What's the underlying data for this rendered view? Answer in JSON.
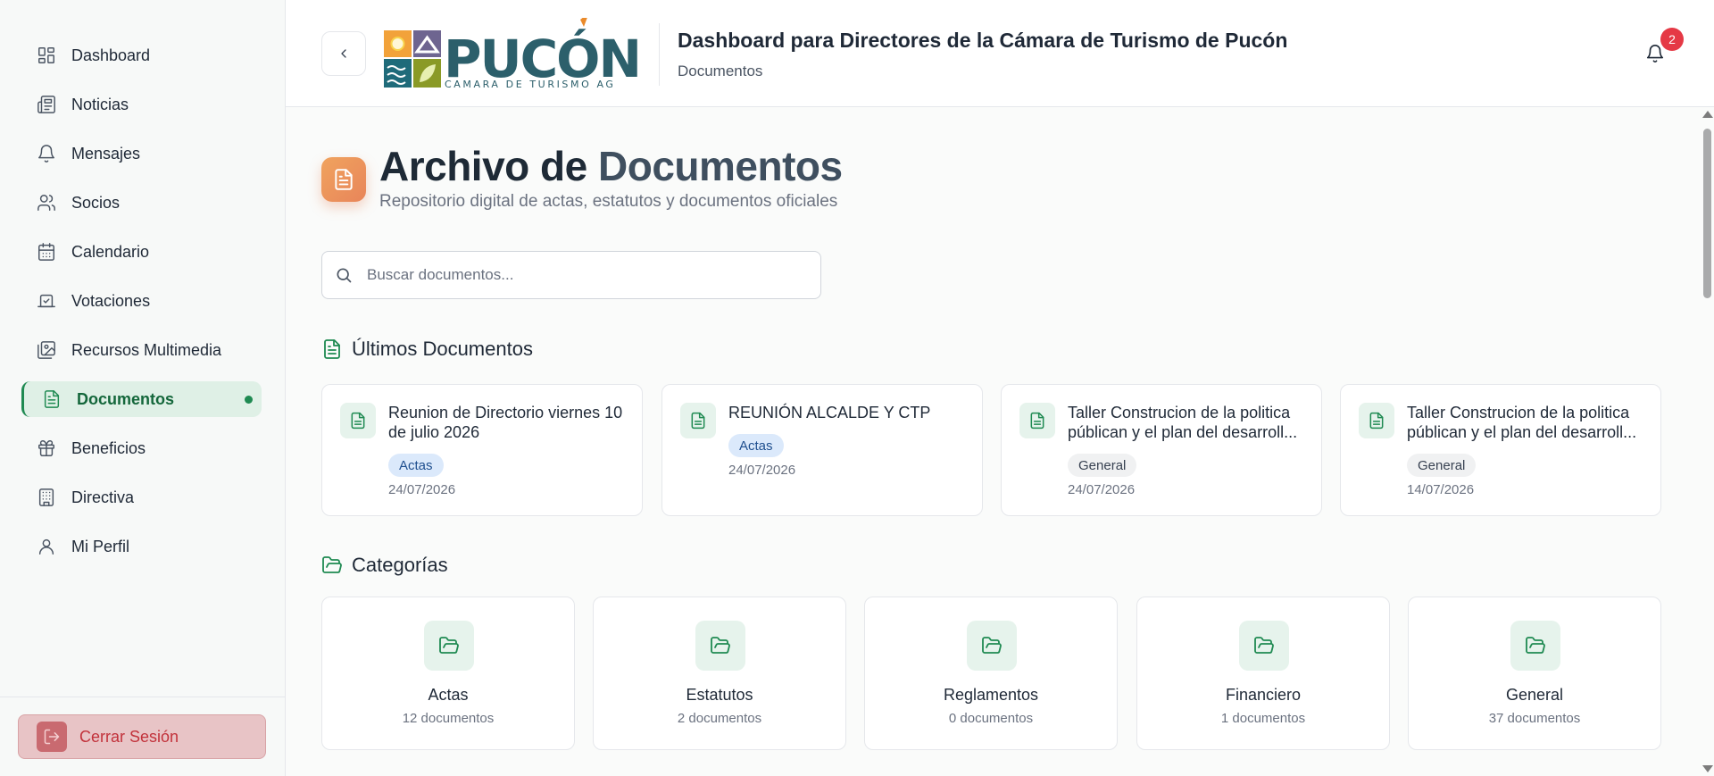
{
  "sidebar": {
    "items": [
      {
        "label": "Dashboard",
        "icon": "dashboard-icon"
      },
      {
        "label": "Noticias",
        "icon": "newspaper-icon"
      },
      {
        "label": "Mensajes",
        "icon": "bell-icon"
      },
      {
        "label": "Socios",
        "icon": "users-icon"
      },
      {
        "label": "Calendario",
        "icon": "calendar-icon"
      },
      {
        "label": "Votaciones",
        "icon": "vote-icon"
      },
      {
        "label": "Recursos Multimedia",
        "icon": "images-icon"
      },
      {
        "label": "Documentos",
        "icon": "file-text-icon",
        "active": true
      },
      {
        "label": "Beneficios",
        "icon": "gift-icon"
      },
      {
        "label": "Directiva",
        "icon": "building-icon"
      },
      {
        "label": "Mi Perfil",
        "icon": "user-icon"
      }
    ],
    "logout_label": "Cerrar Sesión"
  },
  "header": {
    "logo_text": "PUCÓN",
    "logo_subtext": "CAMARA DE TURISMO AG",
    "title": "Dashboard para Directores de la Cámara de Turismo de Pucón",
    "subtitle": "Documentos",
    "notification_count": "2"
  },
  "main": {
    "title_part1": "Archivo de ",
    "title_part2": "Documentos",
    "subtitle": "Repositorio digital de actas, estatutos y documentos oficiales",
    "search_placeholder": "Buscar documentos...",
    "latest_heading": "Últimos Documentos",
    "latest_docs": [
      {
        "title": "Reunion de Directorio viernes 10 de julio 2026",
        "category": "Actas",
        "date": "24/07/2026"
      },
      {
        "title": "REUNIÓN ALCALDE Y CTP",
        "category": "Actas",
        "date": "24/07/2026"
      },
      {
        "title": "Taller Construcion de la politica públican y el plan del desarroll...",
        "category": "General",
        "date": "24/07/2026"
      },
      {
        "title": "Taller Construcion de la politica públican y el plan del desarroll...",
        "category": "General",
        "date": "14/07/2026"
      }
    ],
    "categories_heading": "Categorías",
    "categories": [
      {
        "name": "Actas",
        "count": "12 documentos"
      },
      {
        "name": "Estatutos",
        "count": "2 documentos"
      },
      {
        "name": "Reglamentos",
        "count": "0 documentos"
      },
      {
        "name": "Financiero",
        "count": "1 documentos"
      },
      {
        "name": "General",
        "count": "37 documentos"
      }
    ]
  },
  "colors": {
    "accent_green": "#1f8a52",
    "active_bg": "#dff0e6",
    "logout_bg": "#e8c4c6",
    "logout_text": "#c2323b",
    "badge": "#e53945",
    "tag_blue_bg": "#dbe9fb",
    "tag_gray_bg": "#f0f1f2"
  }
}
